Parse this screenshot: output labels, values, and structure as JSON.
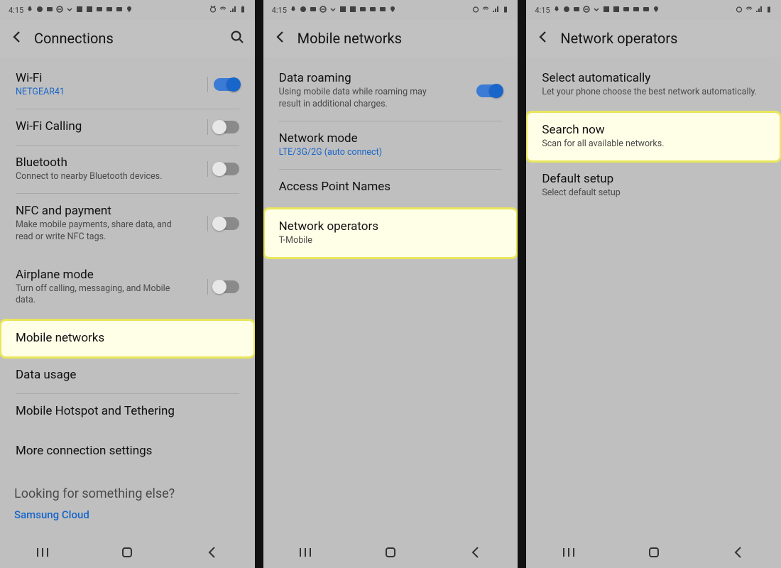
{
  "status": {
    "time": "4:15"
  },
  "screens": {
    "connections": {
      "title": "Connections",
      "wifi": {
        "label": "Wi-Fi",
        "network": "NETGEAR41"
      },
      "wifiCalling": {
        "label": "Wi-Fi Calling"
      },
      "bluetooth": {
        "label": "Bluetooth",
        "desc": "Connect to nearby Bluetooth devices."
      },
      "nfc": {
        "label": "NFC and payment",
        "desc": "Make mobile payments, share data, and read or write NFC tags."
      },
      "airplane": {
        "label": "Airplane mode",
        "desc": "Turn off calling, messaging, and Mobile data."
      },
      "mobileNetworks": {
        "label": "Mobile networks"
      },
      "dataUsage": {
        "label": "Data usage"
      },
      "hotspot": {
        "label": "Mobile Hotspot and Tethering"
      },
      "more": {
        "label": "More connection settings"
      },
      "helpHeading": "Looking for something else?",
      "helpLink": "Samsung Cloud"
    },
    "mobile": {
      "title": "Mobile networks",
      "roaming": {
        "label": "Data roaming",
        "desc": "Using mobile data while roaming may result in additional charges."
      },
      "mode": {
        "label": "Network mode",
        "value": "LTE/3G/2G (auto connect)"
      },
      "apn": {
        "label": "Access Point Names"
      },
      "operators": {
        "label": "Network operators",
        "value": "T-Mobile"
      }
    },
    "operators": {
      "title": "Network operators",
      "auto": {
        "label": "Select automatically",
        "desc": "Let your phone choose the best network automatically."
      },
      "search": {
        "label": "Search now",
        "desc": "Scan for all available networks."
      },
      "default": {
        "label": "Default setup",
        "desc": "Select default setup"
      }
    }
  }
}
